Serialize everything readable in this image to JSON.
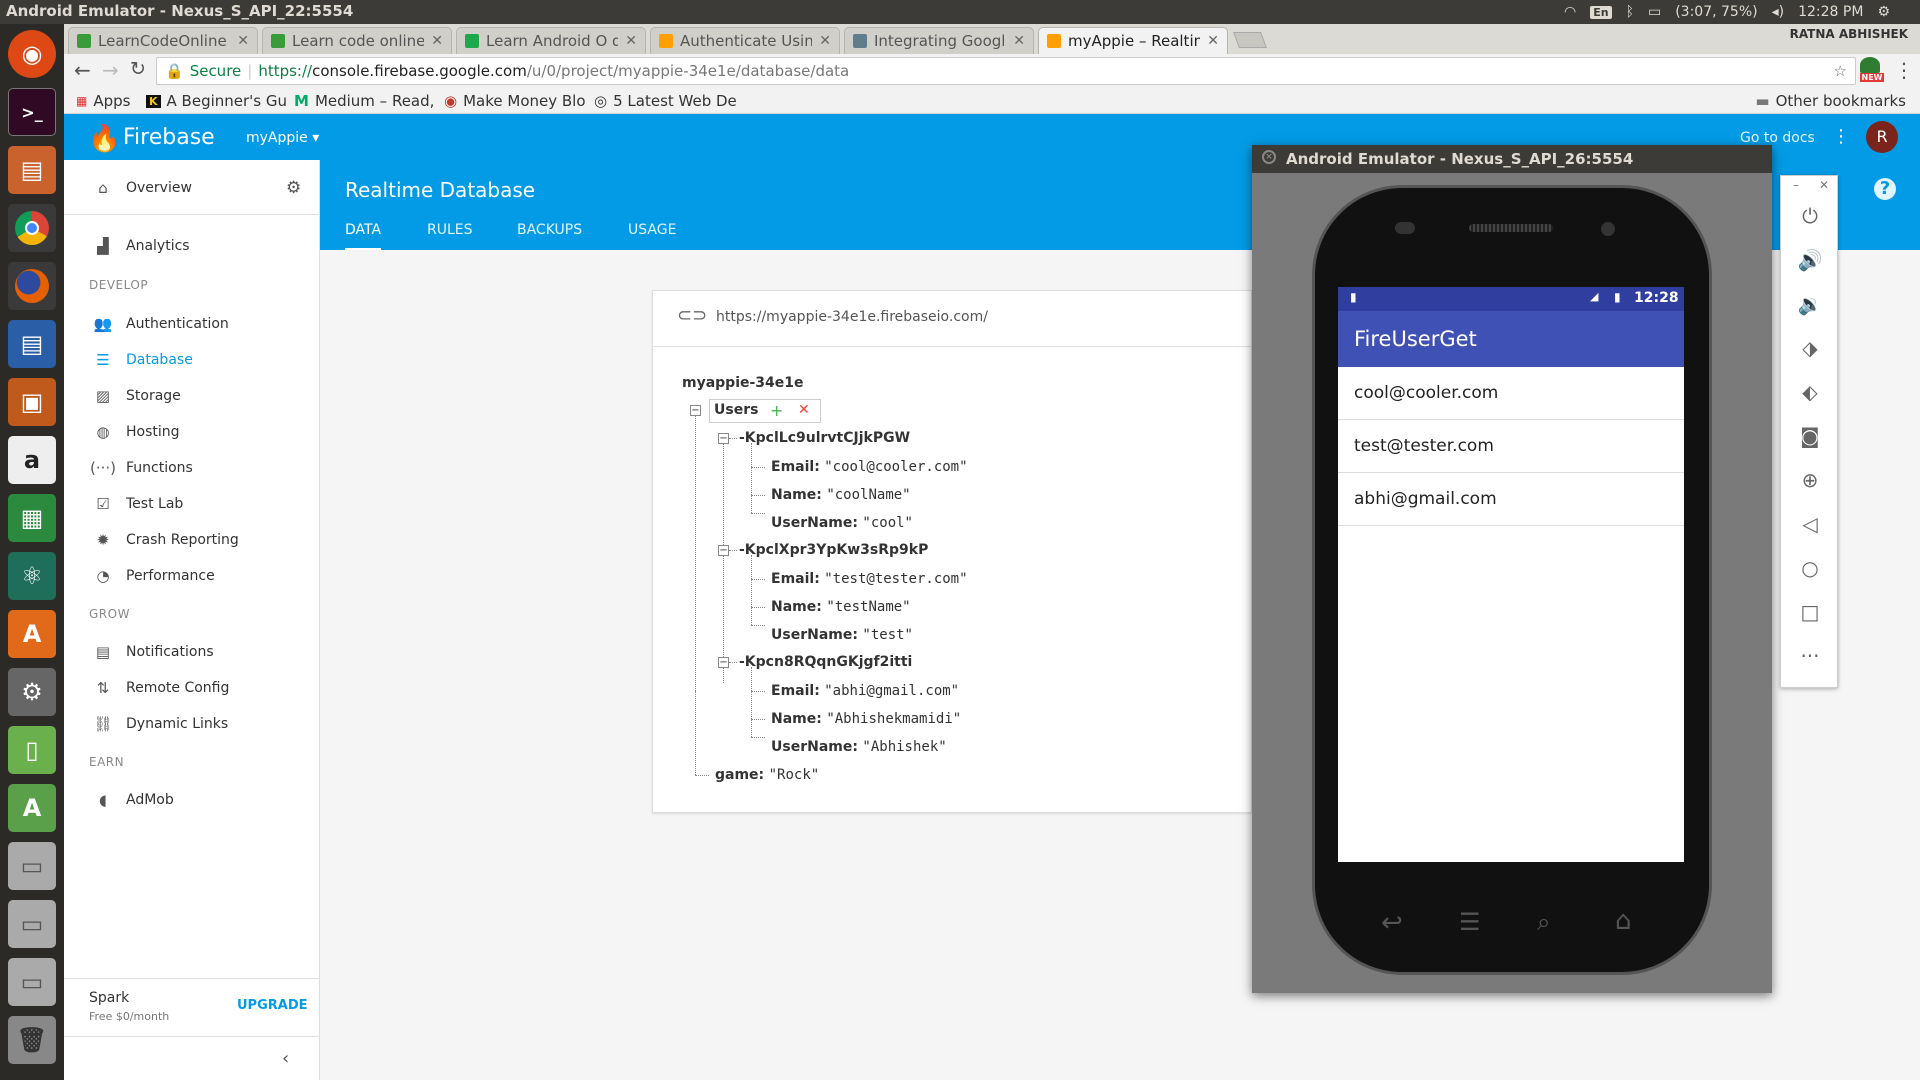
{
  "system": {
    "window_title": "Android Emulator - Nexus_S_API_22:5554",
    "keyboard": "En",
    "battery": "(3:07, 75%)",
    "time": "12:28 PM"
  },
  "browser": {
    "tabs": [
      {
        "label": "LearnCodeOnline",
        "color": "#3a9b3a"
      },
      {
        "label": "Learn code online |",
        "color": "#3a9b3a"
      },
      {
        "label": "Learn Android O de",
        "color": "#1ba94c"
      },
      {
        "label": "Authenticate Using",
        "color": "#ffa000"
      },
      {
        "label": "Integrating Google",
        "color": "#607d8b"
      },
      {
        "label": "myAppie – Realtime",
        "color": "#ffa000"
      }
    ],
    "profile_name": "RATNA ABHISHEK",
    "secure_label": "Secure",
    "url_scheme": "https://",
    "url_host": "console.firebase.google.com",
    "url_path": "/u/0/project/myappie-34e1e/database/data",
    "bookmarks": [
      "Apps",
      "A Beginner's Gu",
      "Medium – Read, ",
      "Make Money Blo",
      "5 Latest Web De"
    ],
    "other_bookmarks": "Other bookmarks",
    "new_badge": "NEW"
  },
  "firebase": {
    "brand": "Firebase",
    "project": "myAppie",
    "go_to_docs": "Go to docs",
    "avatar": "R",
    "page_title": "Realtime Database",
    "tabs": [
      "DATA",
      "RULES",
      "BACKUPS",
      "USAGE"
    ],
    "sidebar": {
      "overview": "Overview",
      "analytics": "Analytics",
      "develop": "DEVELOP",
      "develop_items": [
        "Authentication",
        "Database",
        "Storage",
        "Hosting",
        "Functions",
        "Test Lab",
        "Crash Reporting",
        "Performance"
      ],
      "grow": "GROW",
      "grow_items": [
        "Notifications",
        "Remote Config",
        "Dynamic Links"
      ],
      "earn": "EARN",
      "earn_items": [
        "AdMob"
      ],
      "plan": "Spark",
      "plan_price": "Free $0/month",
      "upgrade": "UPGRADE"
    },
    "db_url": "https://myappie-34e1e.firebaseio.com/",
    "tree": {
      "root": "myappie-34e1e",
      "users_key": "Users",
      "users": [
        {
          "id": "-KpclLc9ulrvtCJjkPGW",
          "email": "\"cool@cooler.com\"",
          "name": "\"coolName\"",
          "username": "\"cool\""
        },
        {
          "id": "-KpclXpr3YpKw3sRp9kP",
          "email": "\"test@tester.com\"",
          "name": "\"testName\"",
          "username": "\"test\""
        },
        {
          "id": "-Kpcn8RQqnGKjgf2itti",
          "email": "\"abhi@gmail.com\"",
          "name": "\"Abhishekmamidi\"",
          "username": "\"Abhishek\""
        }
      ],
      "email_label": "Email:",
      "name_label": "Name:",
      "username_label": "UserName:",
      "game_key": "game:",
      "game_value": "\"Rock\""
    }
  },
  "emulator": {
    "title": "Android Emulator - Nexus_S_API_26:5554",
    "clock": "12:28",
    "app_title": "FireUserGet",
    "emails": [
      "cool@cooler.com",
      "test@tester.com",
      "abhi@gmail.com"
    ]
  }
}
